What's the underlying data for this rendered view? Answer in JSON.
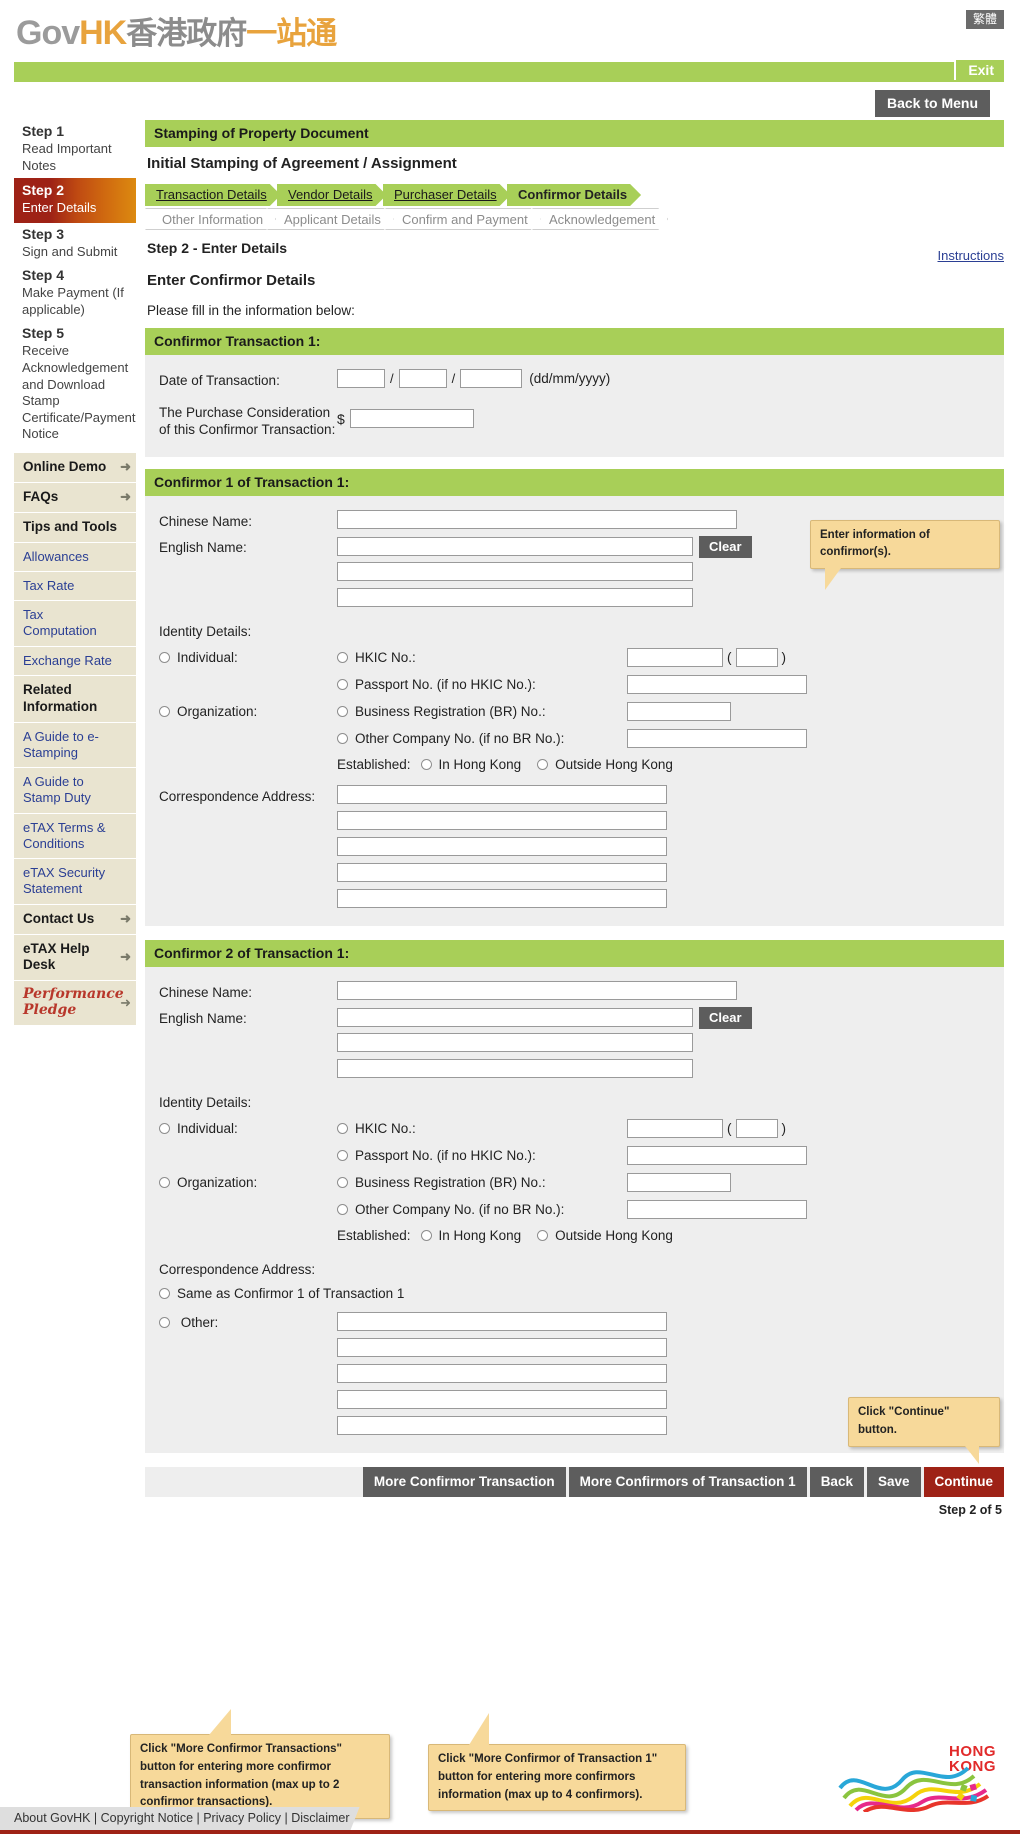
{
  "header": {
    "logo_gov": "Gov",
    "logo_hk": "HK",
    "logo_cn_grey": "香港政府",
    "logo_cn_orange": "一站通",
    "lang_button": "繁體",
    "exit_button": "Exit",
    "back_to_menu": "Back to Menu"
  },
  "sidebar": {
    "steps": [
      {
        "title": "Step 1",
        "desc": "Read Important Notes"
      },
      {
        "title": "Step 2",
        "desc": "Enter Details",
        "active": true
      },
      {
        "title": "Step 3",
        "desc": "Sign and Submit"
      },
      {
        "title": "Step 4",
        "desc": "Make Payment (If applicable)"
      },
      {
        "title": "Step 5",
        "desc": "Receive Acknowledgement and Download Stamp Certificate/Payment Notice"
      }
    ],
    "items": [
      {
        "label": "Online Demo",
        "type": "header",
        "arrow": true
      },
      {
        "label": "FAQs",
        "type": "header",
        "arrow": true
      },
      {
        "label": "Tips and Tools",
        "type": "header",
        "arrow": false
      },
      {
        "label": "Allowances",
        "type": "link"
      },
      {
        "label": "Tax Rate",
        "type": "link"
      },
      {
        "label": "Tax Computation",
        "type": "link"
      },
      {
        "label": "Exchange Rate",
        "type": "link"
      },
      {
        "label": "Related Information",
        "type": "header",
        "arrow": false
      },
      {
        "label": "A Guide to e-Stamping",
        "type": "link"
      },
      {
        "label": "A Guide to Stamp Duty",
        "type": "link"
      },
      {
        "label": "eTAX Terms & Conditions",
        "type": "link"
      },
      {
        "label": "eTAX Security Statement",
        "type": "link"
      },
      {
        "label": "Contact Us",
        "type": "header",
        "arrow": true
      },
      {
        "label": "eTAX Help Desk",
        "type": "header",
        "arrow": true
      }
    ],
    "pledge": {
      "line1": "Performance",
      "line2": "Pledge",
      "arrow": true
    }
  },
  "main": {
    "band_title": "Stamping of Property Document",
    "sub_title": "Initial Stamping of Agreement / Assignment",
    "tabs_row1": [
      {
        "label": "Transaction Details",
        "state": "done"
      },
      {
        "label": "Vendor Details",
        "state": "done"
      },
      {
        "label": "Purchaser Details",
        "state": "done"
      },
      {
        "label": "Confirmor Details",
        "state": "current"
      }
    ],
    "tabs_row2": [
      {
        "label": "Other Information"
      },
      {
        "label": "Applicant Details"
      },
      {
        "label": "Confirm and Payment"
      },
      {
        "label": "Acknowledgement"
      }
    ],
    "step_line": "Step 2 - Enter Details",
    "instructions_link": "Instructions",
    "section_heading": "Enter Confirmor Details",
    "please_fill": "Please fill in the information below:"
  },
  "transaction": {
    "band": "Confirmor Transaction 1:",
    "date_label": "Date of Transaction:",
    "date_day": "",
    "date_month": "",
    "date_year": "",
    "date_format_hint": "(dd/mm/yyyy)",
    "consideration_label": "The Purchase Consideration of this Confirmor Transaction:",
    "currency_symbol": "$",
    "consideration_value": ""
  },
  "confirmor1": {
    "band": "Confirmor 1 of Transaction 1:",
    "chinese_name_label": "Chinese Name:",
    "chinese_name_value": "",
    "english_name_label": "English Name:",
    "english_name_line1": "",
    "english_name_line2": "",
    "english_name_line3": "",
    "clear_button": "Clear",
    "identity_label": "Identity Details:",
    "individual_label": "Individual:",
    "organization_label": "Organization:",
    "hkic_label": "HKIC No.:",
    "hkic_value": "",
    "hkic_check_value": "",
    "passport_label": "Passport No. (if no HKIC No.):",
    "passport_value": "",
    "br_label": "Business Registration (BR) No.:",
    "br_value": "",
    "other_company_label": "Other Company No. (if no BR No.):",
    "other_company_value": "",
    "established_label": "Established:",
    "established_in_hk": "In Hong Kong",
    "established_outside_hk": "Outside Hong Kong",
    "address_label": "Correspondence Address:",
    "address_lines": [
      "",
      "",
      "",
      "",
      ""
    ]
  },
  "confirmor2": {
    "band": "Confirmor 2 of Transaction 1:",
    "chinese_name_label": "Chinese Name:",
    "chinese_name_value": "",
    "english_name_label": "English Name:",
    "english_name_line1": "",
    "english_name_line2": "",
    "english_name_line3": "",
    "clear_button": "Clear",
    "identity_label": "Identity Details:",
    "individual_label": "Individual:",
    "organization_label": "Organization:",
    "hkic_label": "HKIC No.:",
    "hkic_value": "",
    "hkic_check_value": "",
    "passport_label": "Passport No. (if no HKIC No.):",
    "passport_value": "",
    "br_label": "Business Registration (BR) No.:",
    "br_value": "",
    "other_company_label": "Other Company No. (if no BR No.):",
    "other_company_value": "",
    "established_label": "Established:",
    "established_in_hk": "In Hong Kong",
    "established_outside_hk": "Outside Hong Kong",
    "address_label": "Correspondence Address:",
    "same_as_label": "Same as Confirmor 1 of Transaction 1",
    "other_label": "Other:",
    "address_lines": [
      "",
      "",
      "",
      "",
      ""
    ]
  },
  "callouts": {
    "confirmor_info": "Enter information of confirmor(s).",
    "continue_hint": "Click \"Continue\" button.",
    "more_transaction": "Click \"More Confirmor Transactions\" button for entering more confirmor transaction information (max up to 2 confirmor transactions).",
    "more_confirmors": "Click \"More Confirmor of Transaction 1\" button for entering more confirmors  information (max up to 4 confirmors)."
  },
  "actions": {
    "more_transaction": "More Confirmor Transaction",
    "more_confirmors": "More Confirmors of Transaction 1",
    "back": "Back",
    "save": "Save",
    "continue": "Continue",
    "step_count": "Step 2 of 5"
  },
  "footer": {
    "links": "About GovHK | Copyright Notice | Privacy Policy | Disclaimer",
    "brand_line1": "HONG",
    "brand_line2": "KONG"
  },
  "colors": {
    "green": "#a8cf58",
    "dark_red": "#9e2216",
    "orange": "#e8a33d",
    "grey_button": "#5d5d5d",
    "panel": "#eeeeee",
    "sidebar_beige": "#e9e4d0",
    "callout": "#f7d99a"
  }
}
